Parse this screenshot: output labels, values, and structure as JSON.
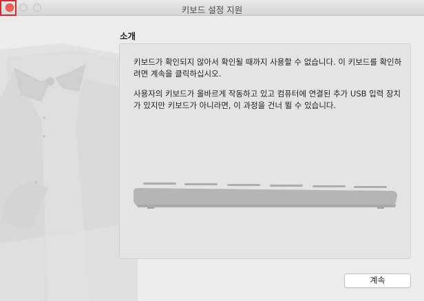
{
  "window": {
    "title": "키보드 설정 지원"
  },
  "section": {
    "heading": "소개"
  },
  "content": {
    "paragraph1": "키보드가 확인되지 않아서 확인될 때까지 사용할 수 없습니다. 이 키보드를 확인하려면 계속을 클릭하십시오.",
    "paragraph2": "사용자의 키보드가 올바르게 작동하고 있고 컴퓨터에 연결된 추가 USB 입력 장치가 있지만 키보드가 아니라면, 이 과정을 건너 뛸 수 있습니다."
  },
  "buttons": {
    "continue_label": "계속"
  },
  "colors": {
    "close_button": "#fc5e57",
    "focus_highlight": "#e0262b",
    "window_background": "#ececec"
  },
  "icons": [
    "close-icon",
    "minimize-icon",
    "zoom-icon",
    "tuxedo-illustration",
    "keyboard-illustration"
  ]
}
